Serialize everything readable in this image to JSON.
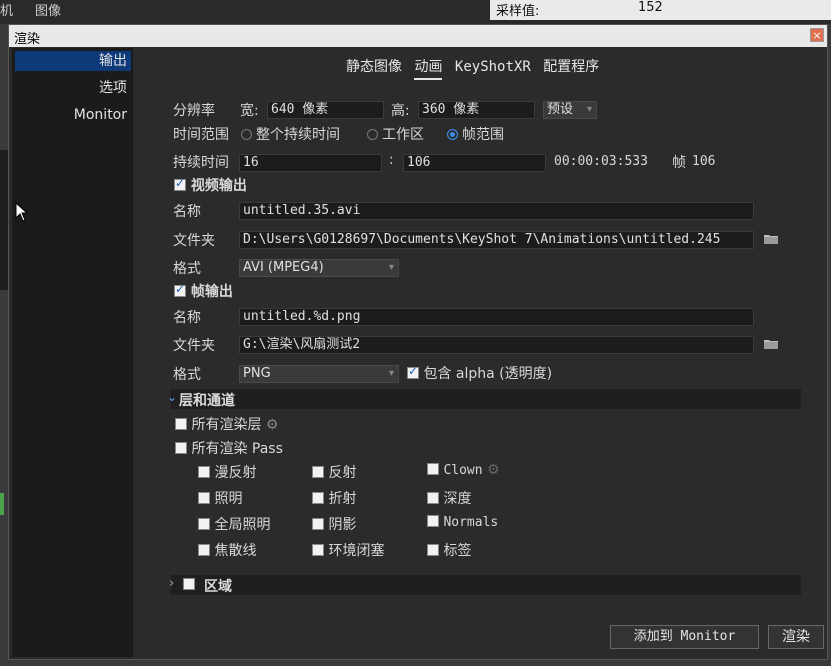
{
  "background": {
    "menu": [
      "机",
      "图像"
    ],
    "panel_label": "采样值:",
    "panel_value": "152"
  },
  "dialog": {
    "title": "渲染",
    "close_label": "×"
  },
  "sidebar": {
    "items": [
      {
        "label": "输出",
        "active": true
      },
      {
        "label": "选项",
        "active": false
      },
      {
        "label": "Monitor",
        "active": false
      }
    ]
  },
  "tabs": [
    {
      "label": "静态图像",
      "active": false
    },
    {
      "label": "动画",
      "active": true
    },
    {
      "label": "KeyShotXR",
      "active": false
    },
    {
      "label": "配置程序",
      "active": false
    }
  ],
  "resolution": {
    "label": "分辨率",
    "width_label": "宽:",
    "width_value": "640 像素",
    "height_label": "高:",
    "height_value": "360 像素",
    "preset_label": "预设"
  },
  "time_range": {
    "label": "时间范围",
    "options": [
      {
        "label": "整个持续时间",
        "selected": false
      },
      {
        "label": "工作区",
        "selected": false
      },
      {
        "label": "帧范围",
        "selected": true
      }
    ]
  },
  "duration": {
    "label": "持续时间",
    "start": "16",
    "separator": ":",
    "end": "106",
    "timecode": "00:00:03:533",
    "frame_label": "帧",
    "frame_value": "106"
  },
  "video_output": {
    "label": "视频输出",
    "checked": true,
    "name_label": "名称",
    "name_value": "untitled.35.avi",
    "folder_label": "文件夹",
    "folder_value": "D:\\Users\\G0128697\\Documents\\KeyShot 7\\Animations\\untitled.245",
    "format_label": "格式",
    "format_value": "AVI (MPEG4)"
  },
  "frame_output": {
    "label": "帧输出",
    "checked": true,
    "name_label": "名称",
    "name_value": "untitled.%d.png",
    "folder_label": "文件夹",
    "folder_value": "G:\\渲染\\风扇测试2",
    "format_label": "格式",
    "format_value": "PNG",
    "alpha_label": "包含 alpha (透明度)",
    "alpha_checked": true
  },
  "layers": {
    "title": "层和通道",
    "all_layers_label": "所有渲染层",
    "all_passes_label": "所有渲染 Pass",
    "passes": [
      [
        "漫反射",
        "反射",
        "Clown"
      ],
      [
        "照明",
        "折射",
        "深度"
      ],
      [
        "全局照明",
        "阴影",
        "Normals"
      ],
      [
        "焦散线",
        "环境闭塞",
        "标签"
      ]
    ]
  },
  "region": {
    "title": "区域"
  },
  "buttons": {
    "add_to_monitor": "添加到 Monitor",
    "render": "渲染"
  },
  "colors": {
    "accent": "#3b8ce8",
    "sidebar_active": "#0f3a7a"
  }
}
